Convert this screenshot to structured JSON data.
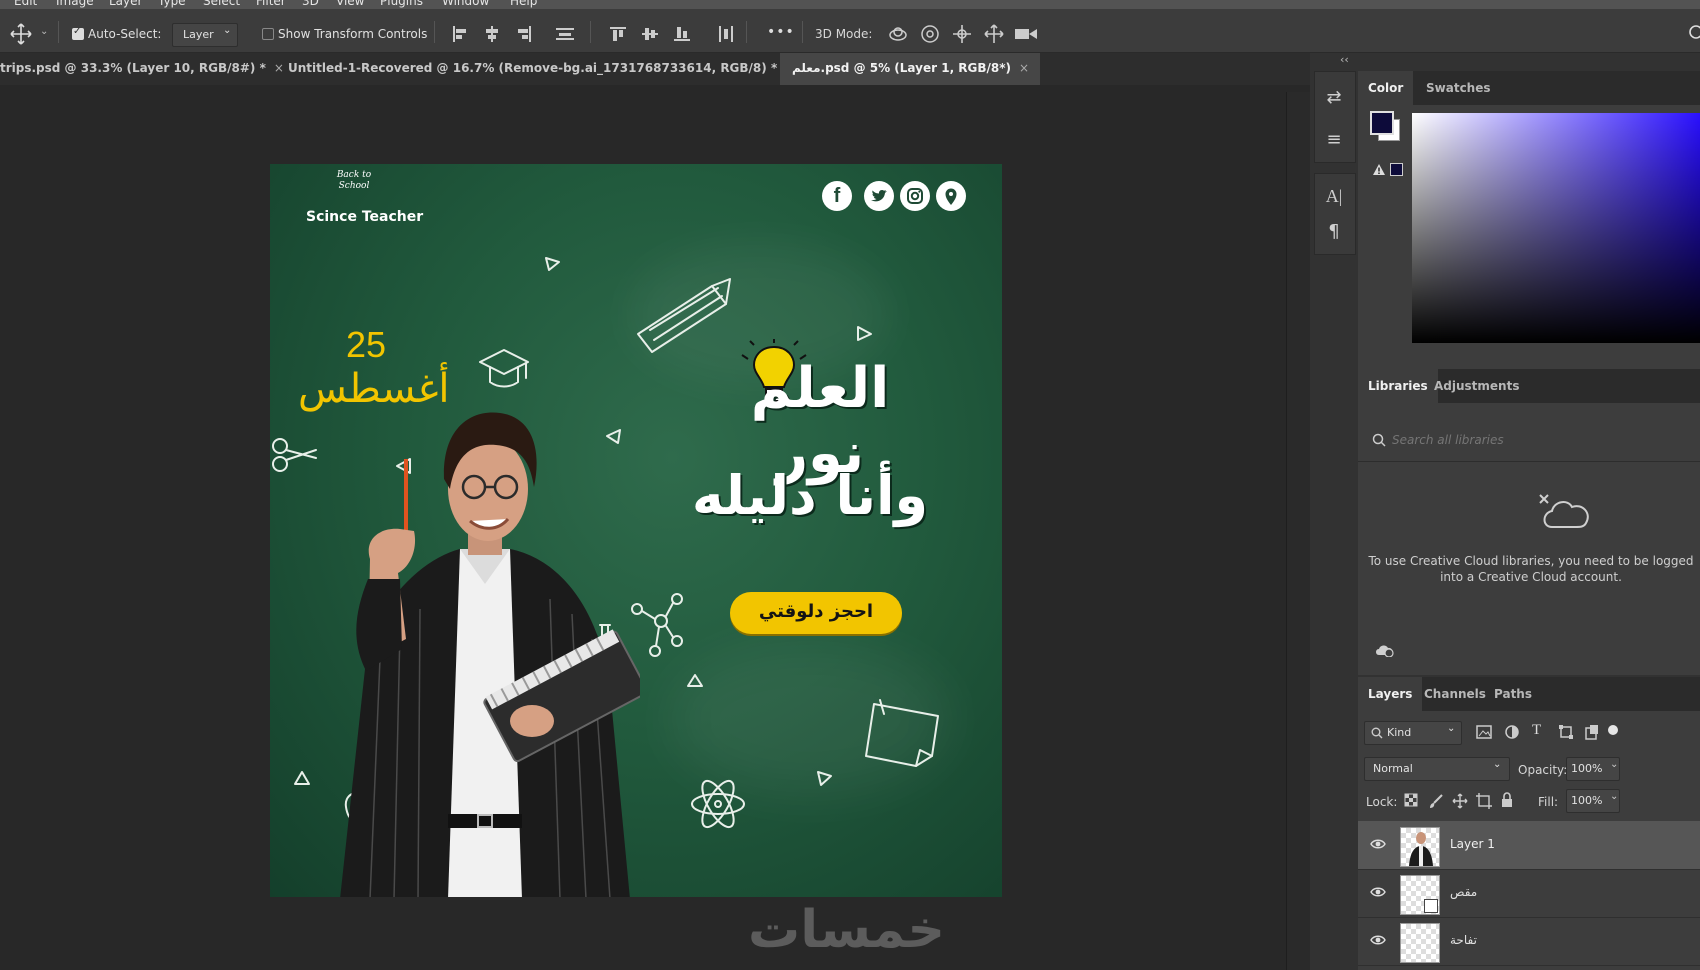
{
  "menu": [
    "Edit",
    "Image",
    "Layer",
    "Type",
    "Select",
    "Filter",
    "3D",
    "View",
    "Plugins",
    "Window",
    "Help"
  ],
  "options": {
    "auto_select_label": "Auto-Select:",
    "auto_select_value": "Layer",
    "show_transform_label": "Show Transform Controls",
    "more_label": "•••",
    "mode_3d_label": "3D Mode:"
  },
  "tabs": [
    {
      "label": "trips.psd @ 33.3% (Layer 10, RGB/8#) *",
      "close": "×"
    },
    {
      "label": "Untitled-1-Recovered @ 16.7% (Remove-bg.ai_1731768733614, RGB/8) *",
      "close": "×"
    },
    {
      "label": "معلم.psd @ 5% (Layer 1, RGB/8*)",
      "close": "×"
    }
  ],
  "design": {
    "brand_name": "Scince Teacher",
    "logo_text": "Back to School",
    "day": "25",
    "month": "أغسطس",
    "headline_1": "العلم نور",
    "headline_2": "وأنا دليله",
    "cta": "احجز دلوقتي"
  },
  "watermark": "خمسات",
  "color_panel": {
    "tabs": [
      "Color",
      "Swatches"
    ],
    "fg_color": "#0d0b3a",
    "bg_color": "#ffffff"
  },
  "libraries": {
    "tabs": [
      "Libraries",
      "Adjustments"
    ],
    "search_placeholder": "Search all libraries",
    "message": "To use Creative Cloud libraries, you need to be logged into a Creative Cloud account."
  },
  "layers_panel": {
    "tabs": [
      "Layers",
      "Channels",
      "Paths"
    ],
    "kind_label": "Kind",
    "blend_mode": "Normal",
    "opacity_label": "Opacity:",
    "opacity_value": "100%",
    "lock_label": "Lock:",
    "fill_label": "Fill:",
    "fill_value": "100%",
    "layers": [
      {
        "name": "Layer 1"
      },
      {
        "name": "مقص"
      },
      {
        "name": "تفاحة"
      }
    ]
  },
  "colors": {
    "accent_yellow": "#f2c500",
    "chalk_green": "#215a3d"
  }
}
